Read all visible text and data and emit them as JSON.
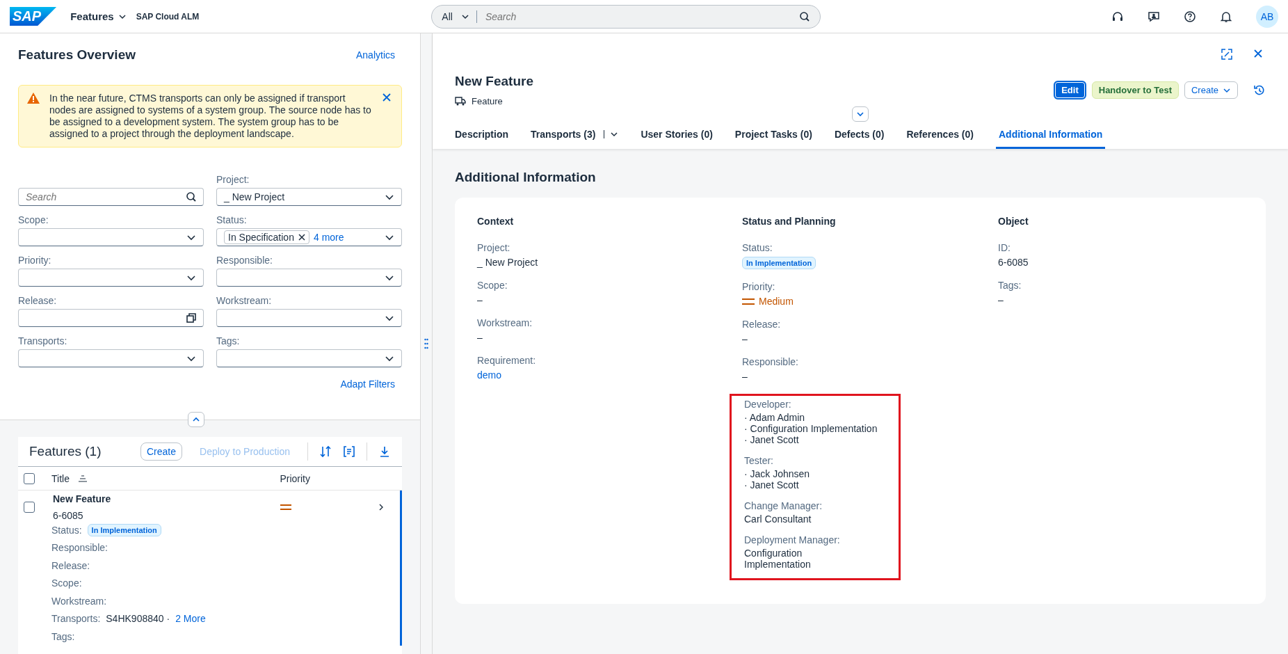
{
  "shell": {
    "logo": "SAP",
    "app_title": "Features",
    "product": "SAP Cloud ALM",
    "search": {
      "scope": "All",
      "placeholder": "Search"
    },
    "avatar": "AB"
  },
  "overview": {
    "title": "Features Overview",
    "link": "Analytics",
    "message": {
      "kind": "warning",
      "text": "In the near future, CTMS transports can only be assigned if transport nodes are assigned to systems of a system group. The source node has to be assigned to a development system. The system group has to be assigned to a project through the deployment landscape."
    },
    "filters": [
      {
        "kind": "search",
        "placeholder": "Search"
      },
      {
        "kind": "select",
        "label": "Project:",
        "value": "_ New Project"
      },
      {
        "kind": "select",
        "label": "Scope:"
      },
      {
        "kind": "tokens",
        "label": "Status:",
        "token": "In Specification",
        "more": "4 more"
      },
      {
        "kind": "select",
        "label": "Priority:"
      },
      {
        "kind": "select",
        "label": "Responsible:"
      },
      {
        "kind": "valuehelp",
        "label": "Release:"
      },
      {
        "kind": "select",
        "label": "Workstream:"
      },
      {
        "kind": "select",
        "label": "Transports:"
      },
      {
        "kind": "select",
        "label": "Tags:"
      }
    ],
    "adapt": "Adapt Filters"
  },
  "table": {
    "title": "Features (1)",
    "actions": [
      {
        "label": "Create",
        "disabled": false
      },
      {
        "label": "Deploy to Production",
        "disabled": true
      }
    ],
    "all_checked": false,
    "columns": [
      "Title",
      "Priority"
    ],
    "rows": [
      {
        "title": "New Feature",
        "id": "6-6085",
        "checked": false,
        "color": "#c35500",
        "attributes": [
          {
            "label": "Status:",
            "kind": "status",
            "value": "In Implementation"
          },
          {
            "label": "Responsible:",
            "kind": "text"
          },
          {
            "label": "Release:",
            "kind": "text"
          },
          {
            "label": "Scope:",
            "kind": "text"
          },
          {
            "label": "Workstream:",
            "kind": "text"
          },
          {
            "label": "Transports:",
            "kind": "text",
            "value": "S4HK908840 ·",
            "link": "2 More"
          },
          {
            "label": "Tags:",
            "kind": "text"
          }
        ]
      }
    ]
  },
  "detail": {
    "title": "New Feature",
    "subtitle": "Feature",
    "buttons": [
      {
        "label": "Edit",
        "kind": "emphasized"
      },
      {
        "label": "Handover to Test",
        "kind": "accept"
      },
      {
        "label": "Create",
        "kind": "menu"
      }
    ],
    "tabs": [
      {
        "label": "Description",
        "selected": false,
        "menu": false
      },
      {
        "label": "Transports (3)",
        "selected": false,
        "menu": true
      },
      {
        "label": "User Stories (0)",
        "selected": false,
        "menu": false
      },
      {
        "label": "Project Tasks (0)",
        "selected": false,
        "menu": false
      },
      {
        "label": "Defects (0)",
        "selected": false,
        "menu": false
      },
      {
        "label": "References (0)",
        "selected": false,
        "menu": false
      },
      {
        "label": "Additional Information",
        "selected": true,
        "menu": false
      }
    ],
    "section_title": "Additional Information",
    "columns": [
      {
        "title": "Context",
        "fields": [
          {
            "label": "Project:",
            "kind": "text",
            "value": "_ New Project"
          },
          {
            "label": "Scope:",
            "kind": "text",
            "value": "–"
          },
          {
            "label": "Workstream:",
            "kind": "text",
            "value": "–"
          },
          {
            "label": "Requirement:",
            "kind": "link",
            "value": "demo"
          }
        ]
      },
      {
        "title": "Status and Planning",
        "fields": [
          {
            "label": "Status:",
            "kind": "status",
            "value": "In Implementation"
          },
          {
            "label": "Priority:",
            "kind": "priority",
            "value": "Medium"
          },
          {
            "label": "Release:",
            "kind": "text",
            "value": "–"
          },
          {
            "label": "Responsible:",
            "kind": "text",
            "value": "–"
          }
        ],
        "roles": {
          "highlighted": true,
          "items": [
            {
              "label": "Developer:",
              "values": [
                "· Adam Admin",
                "· Configuration Implementation",
                "· Janet Scott"
              ]
            },
            {
              "label": "Tester:",
              "values": [
                "· Jack Johnsen",
                "· Janet Scott"
              ]
            },
            {
              "label": "Change Manager:",
              "values": [
                "Carl Consultant"
              ]
            },
            {
              "label": "Deployment Manager:",
              "values": [
                "Configuration",
                "Implementation"
              ]
            }
          ]
        }
      },
      {
        "title": "Object",
        "fields": [
          {
            "label": "ID:",
            "kind": "text",
            "value": "6-6085"
          },
          {
            "label": "Tags:",
            "kind": "text",
            "value": "–"
          }
        ]
      }
    ]
  }
}
